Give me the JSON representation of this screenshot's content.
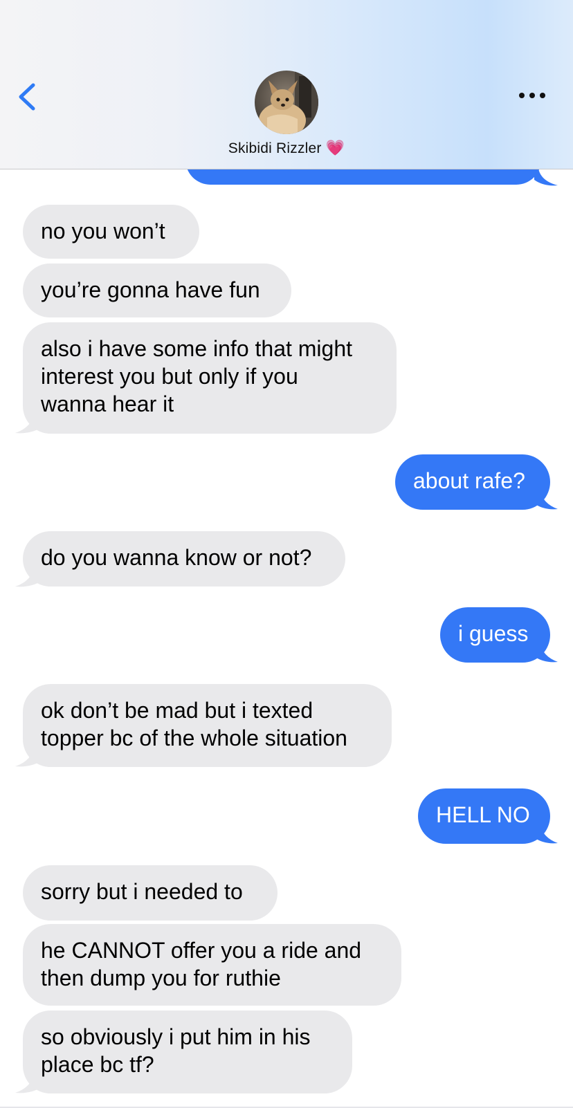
{
  "header": {
    "contact_name": "Skibidi Rizzler",
    "heart": "💗",
    "back_icon": "chevron-left-icon",
    "more_icon": "ellipsis-icon"
  },
  "colors": {
    "outgoing": "#3478f6",
    "incoming": "#e9e9eb",
    "accent": "#2f7bf5"
  },
  "messages": [
    {
      "from": "them",
      "text": "no you won’t"
    },
    {
      "from": "them",
      "text": "you’re gonna have fun"
    },
    {
      "from": "them",
      "lines": [
        "also i have some info that might",
        "interest you but only if you",
        "wanna hear it"
      ]
    },
    {
      "from": "me",
      "text": "about rafe?"
    },
    {
      "from": "them",
      "text": "do you wanna know or not?"
    },
    {
      "from": "me",
      "text": "i guess"
    },
    {
      "from": "them",
      "lines": [
        "ok don’t be mad but i texted",
        "topper bc of the whole situation"
      ]
    },
    {
      "from": "me",
      "text": "HELL NO"
    },
    {
      "from": "them",
      "text": "sorry but i needed to"
    },
    {
      "from": "them",
      "lines": [
        "he CANNOT offer you a ride and",
        "then dump you for ruthie"
      ]
    },
    {
      "from": "them",
      "lines": [
        "so obviously i put him in his",
        "place bc tf?"
      ]
    }
  ]
}
